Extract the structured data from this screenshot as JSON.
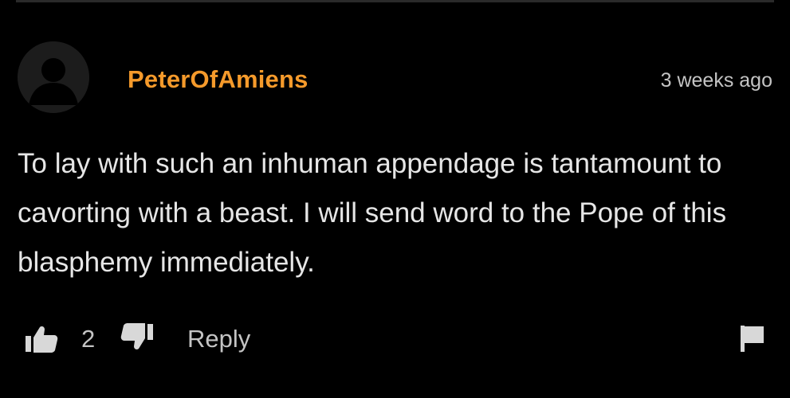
{
  "comment": {
    "username": "PeterOfAmiens",
    "timestamp": "3 weeks ago",
    "body": "To lay with such an inhuman appendage is tantamount to cavorting with a beast. I will send word to the Pope of this blasphemy immediately.",
    "avatar_icon": "default-user-avatar"
  },
  "actions": {
    "upvote_icon": "thumbs-up-icon",
    "vote_count": "2",
    "downvote_icon": "thumbs-down-icon",
    "reply_label": "Reply",
    "flag_icon": "flag-icon"
  },
  "colors": {
    "background": "#000000",
    "username": "#f59a2b",
    "body_text": "#e6e6e6",
    "muted_text": "#c4c4c4",
    "icon": "#d8d8d8"
  }
}
